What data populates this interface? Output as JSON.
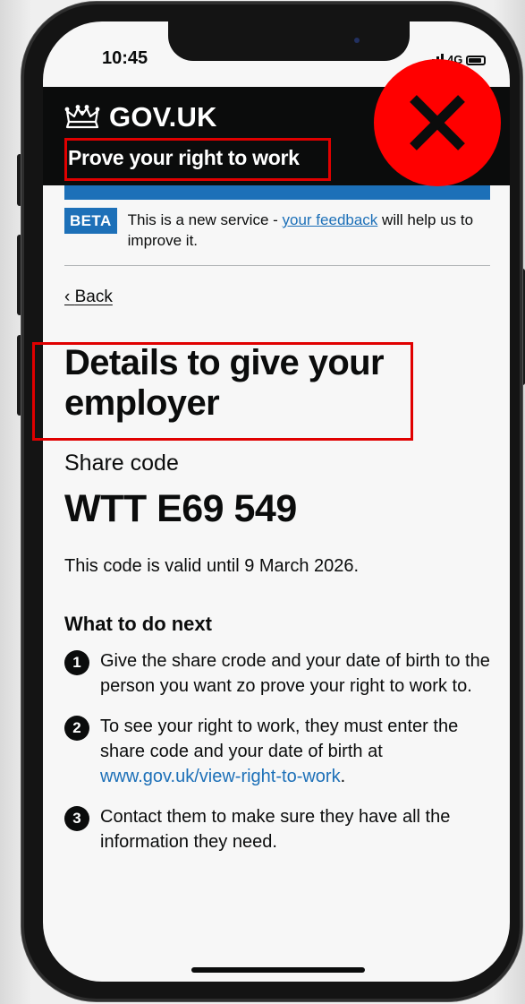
{
  "status_bar": {
    "time": "10:45",
    "network": "4G"
  },
  "header": {
    "brand": "GOV.UK",
    "service_name": "Prove your right to work"
  },
  "beta_banner": {
    "tag": "BETA",
    "text_before": "This is a new service - ",
    "link_text": "your feedback",
    "text_after": " will help us to improve it."
  },
  "nav": {
    "back_label": "Back"
  },
  "main": {
    "title": "Details to give your employer",
    "share_code_label": "Share code",
    "share_code": "WTT E69 549",
    "valid_text": "This code is valid until 9 March 2026.",
    "next_heading": "What to do next",
    "steps": [
      {
        "number": "1",
        "text": "Give the share crode and your date of birth to the person you want zo prove your right to work to."
      },
      {
        "number": "2",
        "text_before": "To see your right to work, they must enter the share code and your date of birth at ",
        "link": "www.gov.uk/view-right-to-work",
        "text_after": "."
      },
      {
        "number": "3",
        "text": "Contact them to make sure they have all the information they need."
      }
    ]
  },
  "annotations": {
    "highlight_color": "#e00000",
    "close_mark_color": "#ff0000"
  },
  "colors": {
    "gov_black": "#0b0c0c",
    "gov_blue": "#1d70b8"
  },
  "icons": {
    "crown": "crown-icon",
    "back": "chevron-left-icon",
    "close": "close-icon"
  }
}
